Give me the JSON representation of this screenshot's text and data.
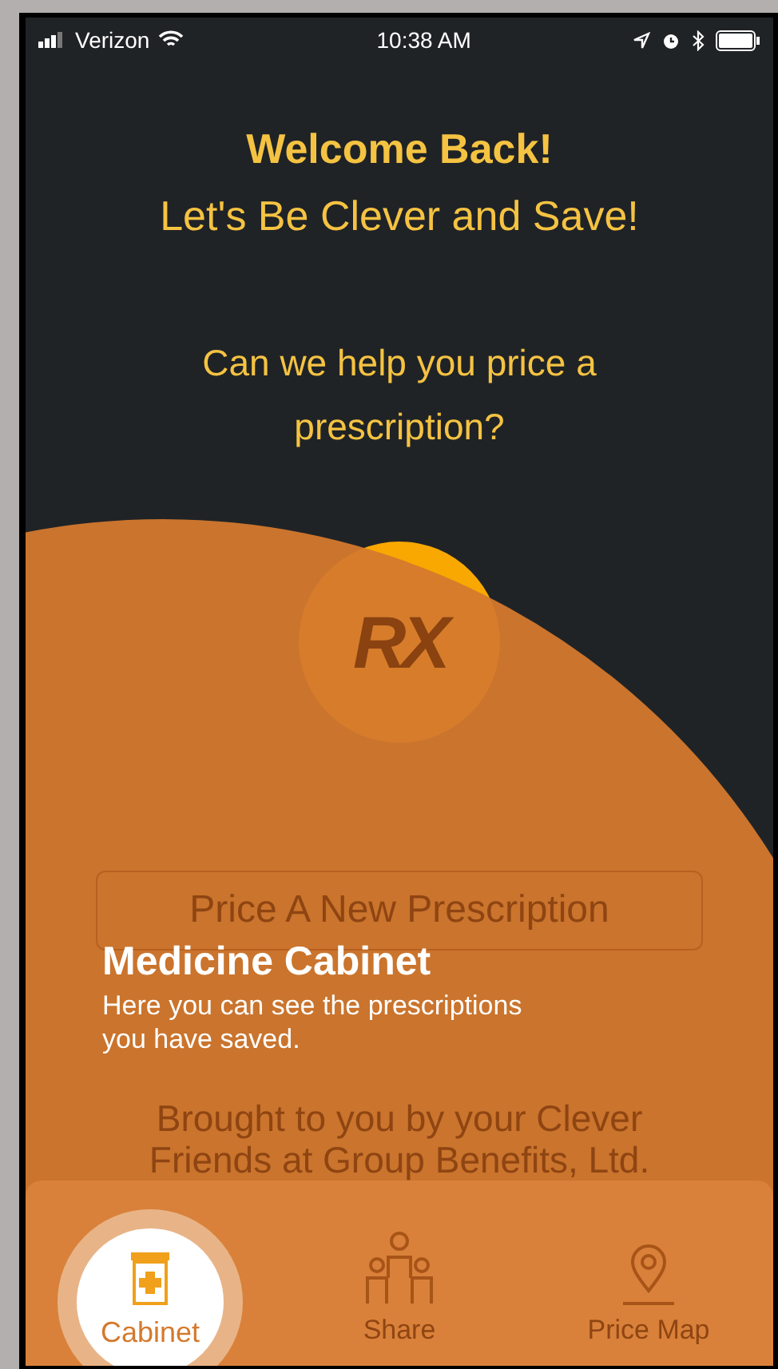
{
  "status_bar": {
    "carrier": "Verizon",
    "time": "10:38 AM"
  },
  "welcome": {
    "title": "Welcome Back!",
    "subtitle": "Let's Be Clever and Save!",
    "question": "Can we help you price a prescription?"
  },
  "logo": {
    "text": "RX"
  },
  "price_button": {
    "label": "Price A New Prescription"
  },
  "footer": [
    "Brought to you by your Clever",
    "Friends at Group Benefits, Ltd."
  ],
  "coach_mark": {
    "title": "Medicine Cabinet",
    "text": "Here you can see the prescriptions you have saved."
  },
  "tabs": [
    {
      "kind": "cabinet",
      "label": "Cabinet",
      "selected": true
    },
    {
      "kind": "share",
      "label": "Share",
      "selected": false
    },
    {
      "kind": "map",
      "label": "Price Map",
      "selected": false
    }
  ]
}
